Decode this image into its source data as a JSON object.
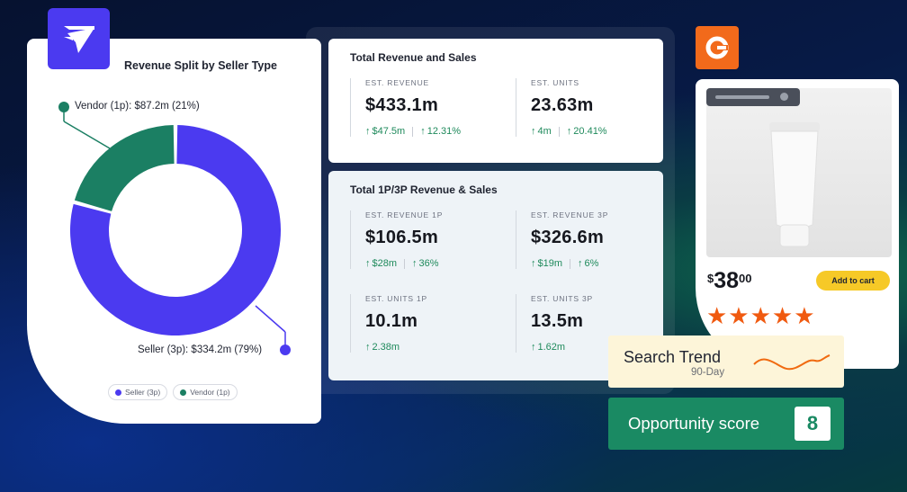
{
  "colors": {
    "brand_purple": "#4b3af0",
    "vendor_green": "#1b7f63",
    "seller_purple": "#4b3af0",
    "positive": "#1f8a5c",
    "orange_brand": "#f26a1b",
    "star": "#f05a10",
    "cart_yellow": "#f6c927",
    "opportunity_green": "#1a8a63"
  },
  "icons": {
    "brand_logo": "paper-plane-icon",
    "orange_logo": "orange-c-logo-icon",
    "up_arrow": "arrow-up-icon",
    "star": "star-icon"
  },
  "donut": {
    "title": "Revenue Split by Seller Type",
    "vendor_label": "Vendor (1p): $87.2m (21%)",
    "seller_label": "Seller (3p): $334.2m (79%)",
    "legend": [
      "Seller (3p)",
      "Vendor (1p)"
    ]
  },
  "chart_data": {
    "type": "pie",
    "title": "Revenue Split by Seller Type",
    "categories": [
      "Vendor (1p)",
      "Seller (3p)"
    ],
    "values": [
      87.2,
      334.2
    ],
    "percent": [
      21,
      79
    ],
    "unit": "$m",
    "colors": [
      "#1b7f63",
      "#4b3af0"
    ],
    "legend": [
      "Seller (3p)",
      "Vendor (1p)"
    ]
  },
  "total_card": {
    "title": "Total Revenue and Sales",
    "metrics": [
      {
        "label": "EST. REVENUE",
        "value": "$433.1m",
        "change_abs": "$47.5m",
        "change_pct": "12.31%"
      },
      {
        "label": "EST. UNITS",
        "value": "23.63m",
        "change_abs": "4m",
        "change_pct": "20.41%"
      }
    ]
  },
  "split_card": {
    "title": "Total 1P/3P Revenue & Sales",
    "metrics": [
      {
        "label": "EST. REVENUE 1P",
        "value": "$106.5m",
        "change_abs": "$28m",
        "change_pct": "36%"
      },
      {
        "label": "EST. REVENUE 3P",
        "value": "$326.6m",
        "change_abs": "$19m",
        "change_pct": "6%"
      },
      {
        "label": "EST. UNITS 1P",
        "value": "10.1m",
        "change_abs": "2.38m"
      },
      {
        "label": "EST. UNITS 3P",
        "value": "13.5m",
        "change_abs": "1.62m"
      }
    ]
  },
  "product": {
    "currency": "$",
    "price_main": "38",
    "price_cents": "00",
    "add_to_cart": "Add to cart",
    "rating": 5,
    "stars": "★★★★★"
  },
  "trend": {
    "title": "Search Trend",
    "subtitle": "90-Day"
  },
  "opportunity": {
    "label": "Opportunity score",
    "score": "8"
  }
}
